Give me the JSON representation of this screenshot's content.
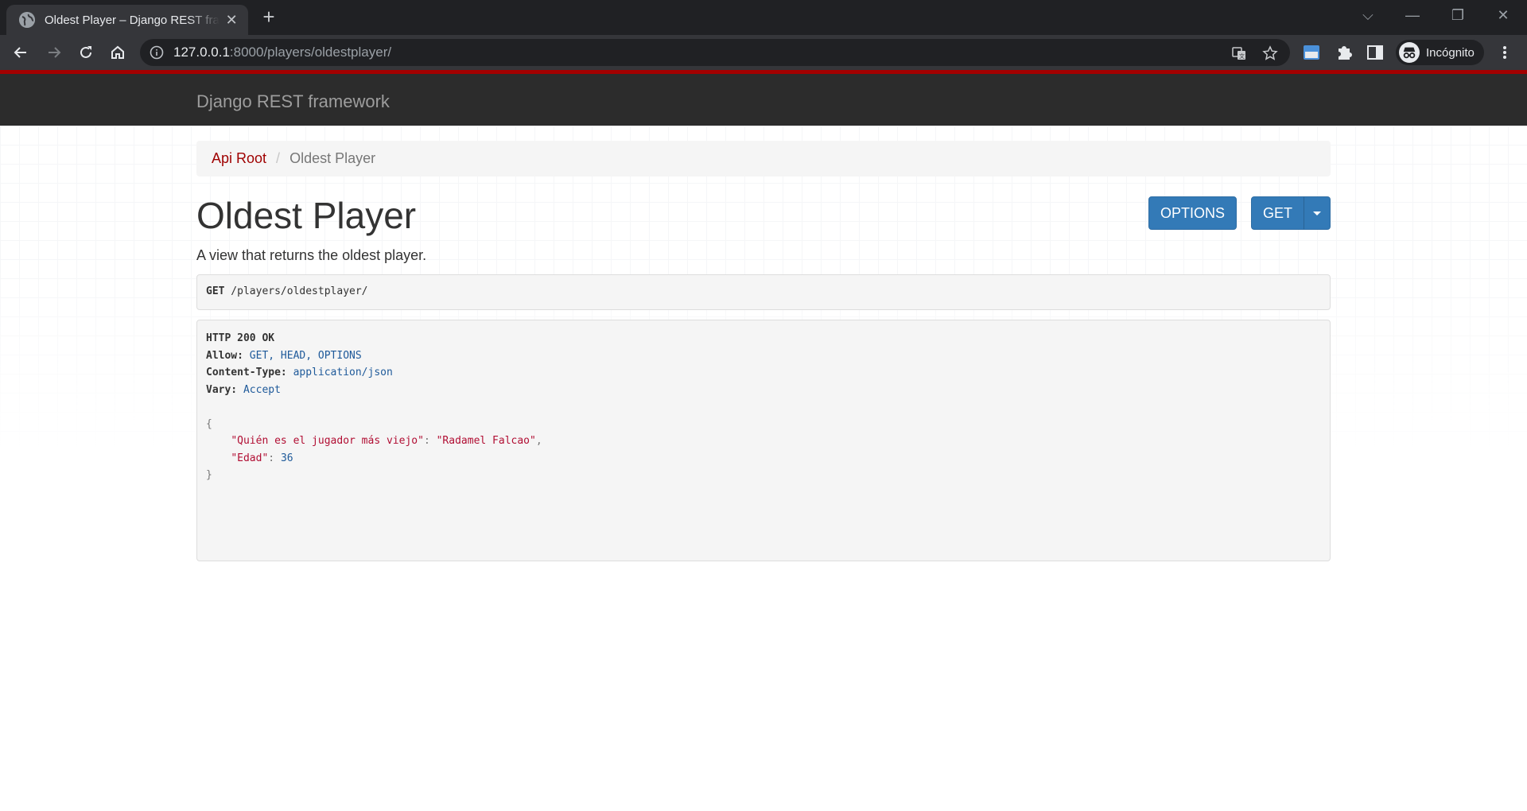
{
  "browser": {
    "tab_title": "Oldest Player – Django REST framework",
    "tab_close": "✕",
    "new_tab": "+",
    "url_host": "127.0.0.1",
    "url_rest": ":8000/players/oldestplayer/",
    "incognito_label": "Incógnito",
    "window_controls": {
      "dropdown": "⌵",
      "minimize": "—",
      "restore": "❐",
      "close": "✕"
    }
  },
  "navbar": {
    "brand": "Django REST framework"
  },
  "breadcrumb": {
    "root": "Api Root",
    "separator": "/",
    "current": "Oldest Player"
  },
  "page": {
    "title": "Oldest Player",
    "description": "A view that returns the oldest player."
  },
  "buttons": {
    "options": "OPTIONS",
    "get": "GET"
  },
  "request": {
    "method": "GET",
    "path": " /players/oldestplayer/"
  },
  "response": {
    "status": "HTTP 200 OK",
    "headers": [
      {
        "name": "Allow:",
        "value": " GET, HEAD, OPTIONS"
      },
      {
        "name": "Content-Type:",
        "value": " application/json"
      },
      {
        "name": "Vary:",
        "value": " Accept"
      }
    ],
    "body": {
      "open": "{",
      "key1": "\"Quién es el jugador más viejo\"",
      "value1": "\"Radamel Falcao\"",
      "key2": "\"Edad\"",
      "value2": "36",
      "close": "}"
    }
  },
  "colors": {
    "navbar_bg": "#2c2c2c",
    "navbar_accent": "#a30000",
    "button": "#337ab7",
    "link": "#9f0000"
  }
}
